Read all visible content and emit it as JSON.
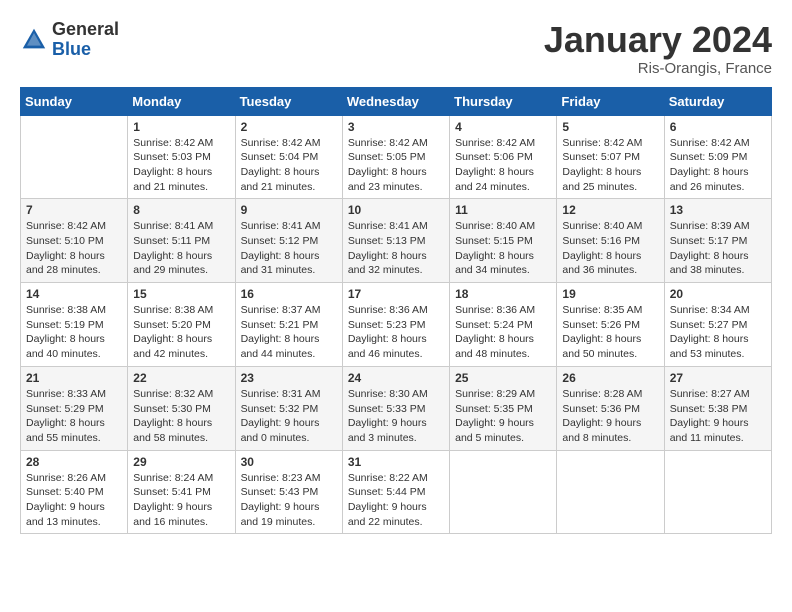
{
  "header": {
    "logo_general": "General",
    "logo_blue": "Blue",
    "month_year": "January 2024",
    "location": "Ris-Orangis, France"
  },
  "calendar": {
    "days_of_week": [
      "Sunday",
      "Monday",
      "Tuesday",
      "Wednesday",
      "Thursday",
      "Friday",
      "Saturday"
    ],
    "weeks": [
      [
        {
          "day": "",
          "info": ""
        },
        {
          "day": "1",
          "info": "Sunrise: 8:42 AM\nSunset: 5:03 PM\nDaylight: 8 hours\nand 21 minutes."
        },
        {
          "day": "2",
          "info": "Sunrise: 8:42 AM\nSunset: 5:04 PM\nDaylight: 8 hours\nand 21 minutes."
        },
        {
          "day": "3",
          "info": "Sunrise: 8:42 AM\nSunset: 5:05 PM\nDaylight: 8 hours\nand 23 minutes."
        },
        {
          "day": "4",
          "info": "Sunrise: 8:42 AM\nSunset: 5:06 PM\nDaylight: 8 hours\nand 24 minutes."
        },
        {
          "day": "5",
          "info": "Sunrise: 8:42 AM\nSunset: 5:07 PM\nDaylight: 8 hours\nand 25 minutes."
        },
        {
          "day": "6",
          "info": "Sunrise: 8:42 AM\nSunset: 5:09 PM\nDaylight: 8 hours\nand 26 minutes."
        }
      ],
      [
        {
          "day": "7",
          "info": "Sunrise: 8:42 AM\nSunset: 5:10 PM\nDaylight: 8 hours\nand 28 minutes."
        },
        {
          "day": "8",
          "info": "Sunrise: 8:41 AM\nSunset: 5:11 PM\nDaylight: 8 hours\nand 29 minutes."
        },
        {
          "day": "9",
          "info": "Sunrise: 8:41 AM\nSunset: 5:12 PM\nDaylight: 8 hours\nand 31 minutes."
        },
        {
          "day": "10",
          "info": "Sunrise: 8:41 AM\nSunset: 5:13 PM\nDaylight: 8 hours\nand 32 minutes."
        },
        {
          "day": "11",
          "info": "Sunrise: 8:40 AM\nSunset: 5:15 PM\nDaylight: 8 hours\nand 34 minutes."
        },
        {
          "day": "12",
          "info": "Sunrise: 8:40 AM\nSunset: 5:16 PM\nDaylight: 8 hours\nand 36 minutes."
        },
        {
          "day": "13",
          "info": "Sunrise: 8:39 AM\nSunset: 5:17 PM\nDaylight: 8 hours\nand 38 minutes."
        }
      ],
      [
        {
          "day": "14",
          "info": "Sunrise: 8:38 AM\nSunset: 5:19 PM\nDaylight: 8 hours\nand 40 minutes."
        },
        {
          "day": "15",
          "info": "Sunrise: 8:38 AM\nSunset: 5:20 PM\nDaylight: 8 hours\nand 42 minutes."
        },
        {
          "day": "16",
          "info": "Sunrise: 8:37 AM\nSunset: 5:21 PM\nDaylight: 8 hours\nand 44 minutes."
        },
        {
          "day": "17",
          "info": "Sunrise: 8:36 AM\nSunset: 5:23 PM\nDaylight: 8 hours\nand 46 minutes."
        },
        {
          "day": "18",
          "info": "Sunrise: 8:36 AM\nSunset: 5:24 PM\nDaylight: 8 hours\nand 48 minutes."
        },
        {
          "day": "19",
          "info": "Sunrise: 8:35 AM\nSunset: 5:26 PM\nDaylight: 8 hours\nand 50 minutes."
        },
        {
          "day": "20",
          "info": "Sunrise: 8:34 AM\nSunset: 5:27 PM\nDaylight: 8 hours\nand 53 minutes."
        }
      ],
      [
        {
          "day": "21",
          "info": "Sunrise: 8:33 AM\nSunset: 5:29 PM\nDaylight: 8 hours\nand 55 minutes."
        },
        {
          "day": "22",
          "info": "Sunrise: 8:32 AM\nSunset: 5:30 PM\nDaylight: 8 hours\nand 58 minutes."
        },
        {
          "day": "23",
          "info": "Sunrise: 8:31 AM\nSunset: 5:32 PM\nDaylight: 9 hours\nand 0 minutes."
        },
        {
          "day": "24",
          "info": "Sunrise: 8:30 AM\nSunset: 5:33 PM\nDaylight: 9 hours\nand 3 minutes."
        },
        {
          "day": "25",
          "info": "Sunrise: 8:29 AM\nSunset: 5:35 PM\nDaylight: 9 hours\nand 5 minutes."
        },
        {
          "day": "26",
          "info": "Sunrise: 8:28 AM\nSunset: 5:36 PM\nDaylight: 9 hours\nand 8 minutes."
        },
        {
          "day": "27",
          "info": "Sunrise: 8:27 AM\nSunset: 5:38 PM\nDaylight: 9 hours\nand 11 minutes."
        }
      ],
      [
        {
          "day": "28",
          "info": "Sunrise: 8:26 AM\nSunset: 5:40 PM\nDaylight: 9 hours\nand 13 minutes."
        },
        {
          "day": "29",
          "info": "Sunrise: 8:24 AM\nSunset: 5:41 PM\nDaylight: 9 hours\nand 16 minutes."
        },
        {
          "day": "30",
          "info": "Sunrise: 8:23 AM\nSunset: 5:43 PM\nDaylight: 9 hours\nand 19 minutes."
        },
        {
          "day": "31",
          "info": "Sunrise: 8:22 AM\nSunset: 5:44 PM\nDaylight: 9 hours\nand 22 minutes."
        },
        {
          "day": "",
          "info": ""
        },
        {
          "day": "",
          "info": ""
        },
        {
          "day": "",
          "info": ""
        }
      ]
    ]
  }
}
